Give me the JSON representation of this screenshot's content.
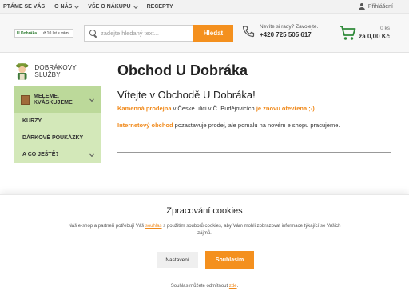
{
  "topnav": {
    "items": [
      {
        "label": "PTÁME SE VÁS"
      },
      {
        "label": "O NÁS"
      },
      {
        "label": "VŠE O NÁKUPU"
      },
      {
        "label": "RECEPTY"
      }
    ],
    "login_label": "Přihlášení"
  },
  "header": {
    "logo_text": "už 10 let s vámi",
    "logo_mark": "U Dobráka",
    "search_placeholder": "zadejte hledaný text...",
    "search_button": "Hledat",
    "phone_question": "Nevíte si rady? Zavolejte.",
    "phone_number": "+420 725 505 617",
    "cart_count": "0 ks",
    "cart_total": "za 0,00 Kč"
  },
  "sidebar": {
    "title": "DOBRÁKOVY SLUŽBY",
    "items": [
      {
        "label": "MELEME, KVÁSKUJEME"
      },
      {
        "label": "KURZY"
      },
      {
        "label": "DÁRKOVÉ POUKÁZKY"
      },
      {
        "label": "A CO JEŠTĚ?"
      }
    ]
  },
  "main": {
    "title": "Obchod U Dobráka",
    "welcome": "Vítejte v Obchodě U Dobráka!",
    "line1": {
      "store": "Kamenná prodejna",
      "mid": " v České ulici v Č. Budějovicích ",
      "status": "je znovu otevřena ;-)"
    },
    "line2": {
      "eshop": "Internetový obchod",
      "rest": " pozastavuje prodej, ale pomalu na novém e shopu pracujeme."
    }
  },
  "cookie": {
    "title": "Zpracování cookies",
    "text_before": "Náš e-shop a partneři potřebují Váš ",
    "text_link": "souhlas",
    "text_after": " s použitím souborů cookies, aby Vám mohli zobrazovat informace týkající se Vašich zájmů.",
    "settings_button": "Nastavení",
    "agree_button": "Souhlasím",
    "footer_before": "Souhlas můžete odmítnout ",
    "footer_link": "zde",
    "footer_after": "."
  },
  "colors": {
    "accent": "#f4901e",
    "sidebar_bg": "#d3e8b9",
    "sidebar_active": "#bcd99a"
  }
}
